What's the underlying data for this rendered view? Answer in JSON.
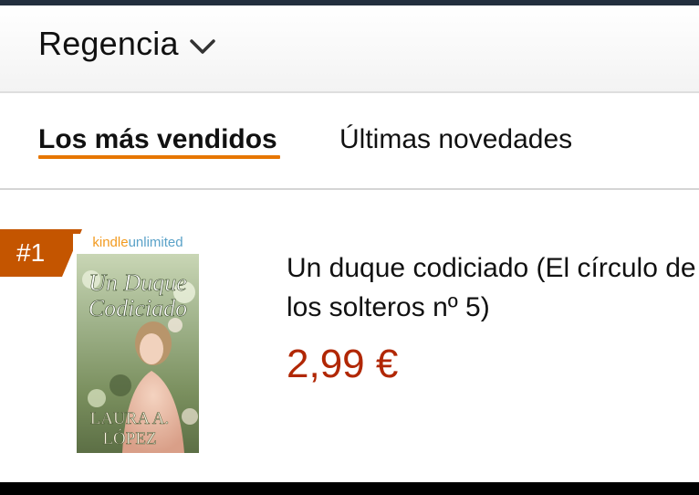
{
  "header": {
    "category_label": "Regencia",
    "dropdown_icon": "chevron-down-icon"
  },
  "tabs": [
    {
      "label": "Los más vendidos",
      "selected": true
    },
    {
      "label": "Últimas novedades",
      "selected": false
    }
  ],
  "colors": {
    "accent_underline": "#e77600",
    "rank_badge": "#c45500",
    "price": "#b12704",
    "top_bar": "#232f3e"
  },
  "products": [
    {
      "rank": "#1",
      "cover": {
        "badge": "kindleunlimited",
        "title_lines": [
          "Un Duque",
          "Codiciado"
        ],
        "author_lines": [
          "LAURA A.",
          "LÓPEZ"
        ]
      },
      "title": "Un duque codiciado (El círculo de los solteros nº 5)",
      "price": "2,99 €"
    }
  ]
}
